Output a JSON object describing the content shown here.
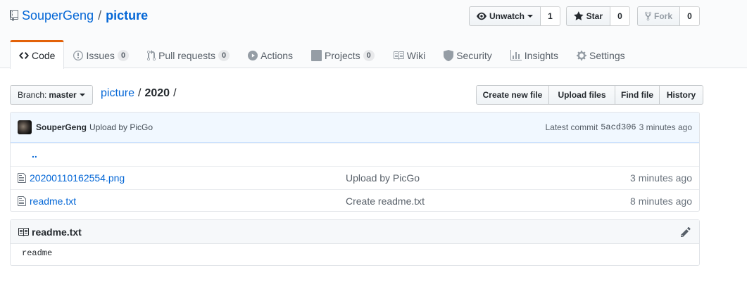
{
  "repo": {
    "owner": "SouperGeng",
    "separator": "/",
    "name": "picture"
  },
  "actions": {
    "watch_label": "Unwatch",
    "watch_count": "1",
    "star_label": "Star",
    "star_count": "0",
    "fork_label": "Fork",
    "fork_count": "0"
  },
  "tabs": [
    {
      "label": "Code",
      "icon": "code-icon",
      "selected": true
    },
    {
      "label": "Issues",
      "count": "0",
      "icon": "issue-icon"
    },
    {
      "label": "Pull requests",
      "count": "0",
      "icon": "pull-request-icon"
    },
    {
      "label": "Actions",
      "icon": "play-icon"
    },
    {
      "label": "Projects",
      "count": "0",
      "icon": "project-icon"
    },
    {
      "label": "Wiki",
      "icon": "book-icon"
    },
    {
      "label": "Security",
      "icon": "shield-icon"
    },
    {
      "label": "Insights",
      "icon": "graph-icon"
    },
    {
      "label": "Settings",
      "icon": "gear-icon"
    }
  ],
  "branch": {
    "prefix": "Branch:",
    "name": "master"
  },
  "breadcrumb": {
    "root": "picture",
    "sep": "/",
    "current": "2020",
    "trail": "/"
  },
  "file_nav": [
    "Create new file",
    "Upload files",
    "Find file",
    "History"
  ],
  "commit": {
    "author": "SouperGeng",
    "message": "Upload by PicGo",
    "latest_label": "Latest commit",
    "sha": "5acd306",
    "age": "3 minutes ago"
  },
  "up_dir": "..",
  "files": [
    {
      "name": "20200110162554.png",
      "message": "Upload by PicGo",
      "age": "3 minutes ago"
    },
    {
      "name": "readme.txt",
      "message": "Create readme.txt",
      "age": "8 minutes ago"
    }
  ],
  "readme": {
    "title": "readme.txt",
    "content": "readme"
  },
  "colors": {
    "link": "#0366d6",
    "accent_tab": "#e36209",
    "commit_bg": "#f1f8ff"
  }
}
